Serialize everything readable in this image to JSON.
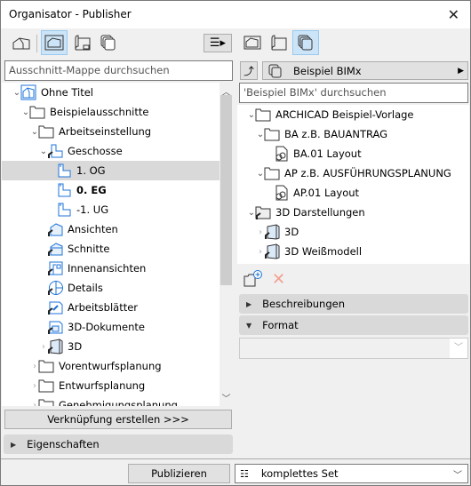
{
  "window": {
    "title": "Organisator - Publisher"
  },
  "left": {
    "search_placeholder": "Ausschnitt-Mappe durchsuchen",
    "tree": [
      {
        "label": "Ohne Titel",
        "level": 0,
        "chevron": "open",
        "icon": "project-icon"
      },
      {
        "label": "Beispielausschnitte",
        "level": 1,
        "chevron": "open",
        "icon": "folder-icon"
      },
      {
        "label": "Arbeitseinstellung",
        "level": 2,
        "chevron": "open",
        "icon": "folder-icon"
      },
      {
        "label": "Geschosse",
        "level": 3,
        "chevron": "open",
        "icon": "floor-plan-icon"
      },
      {
        "label": "1. OG",
        "level": 4,
        "icon": "story-icon",
        "selected": true
      },
      {
        "label": "0. EG",
        "level": 4,
        "icon": "story-icon",
        "bold": true
      },
      {
        "label": "-1. UG",
        "level": 4,
        "icon": "story-icon"
      },
      {
        "label": "Ansichten",
        "level": 3,
        "icon": "elevation-icon"
      },
      {
        "label": "Schnitte",
        "level": 3,
        "icon": "section-icon"
      },
      {
        "label": "Innenansichten",
        "level": 3,
        "icon": "interior-elevation-icon"
      },
      {
        "label": "Details",
        "level": 3,
        "icon": "detail-icon"
      },
      {
        "label": "Arbeitsblätter",
        "level": 3,
        "icon": "worksheet-icon"
      },
      {
        "label": "3D-Dokumente",
        "level": 3,
        "icon": "3d-document-icon"
      },
      {
        "label": "3D",
        "level": 3,
        "chevron": "closed",
        "icon": "3d-icon"
      },
      {
        "label": "Vorentwurfsplanung",
        "level": 2,
        "chevron": "closed",
        "icon": "folder-icon"
      },
      {
        "label": "Entwurfsplanung",
        "level": 2,
        "chevron": "closed",
        "icon": "folder-icon"
      },
      {
        "label": "Genehmigungsplanung",
        "level": 2,
        "chevron": "closed",
        "icon": "folder-icon"
      }
    ],
    "link_button": "Verknüpfung erstellen >>>",
    "properties": "Eigenschaften"
  },
  "right": {
    "set_name": "Beispiel BIMx",
    "search_placeholder": "'Beispiel BIMx' durchsuchen",
    "tree": [
      {
        "label": "ARCHICAD Beispiel-Vorlage",
        "level": 0,
        "chevron": "open",
        "icon": "folder-icon"
      },
      {
        "label": "BA z.B. BAUANTRAG",
        "level": 1,
        "chevron": "open",
        "icon": "folder-icon"
      },
      {
        "label": "BA.01 Layout",
        "level": 2,
        "icon": "layout-icon"
      },
      {
        "label": "AP z.B. AUSFÜHRUNGSPLANUNG",
        "level": 1,
        "chevron": "open",
        "icon": "folder-icon"
      },
      {
        "label": "AP.01 Layout",
        "level": 2,
        "icon": "layout-icon"
      },
      {
        "label": "3D Darstellungen",
        "level": 0,
        "chevron": "open",
        "icon": "folder-shortcut-icon"
      },
      {
        "label": "3D",
        "level": 1,
        "chevron": "closed",
        "icon": "3d-icon"
      },
      {
        "label": "3D Weißmodell",
        "level": 1,
        "chevron": "closed",
        "icon": "3d-icon"
      }
    ],
    "descriptions": "Beschreibungen",
    "format": "Format",
    "format_value": ""
  },
  "footer": {
    "publish": "Publizieren",
    "set_option": "komplettes Set"
  },
  "colors": {
    "accent": "#cce4f7",
    "icon_blue": "#1e73d8",
    "delete_red": "#f4a090"
  }
}
